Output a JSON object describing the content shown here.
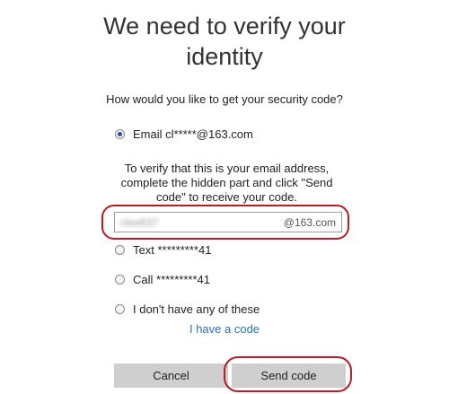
{
  "header": {
    "title_line1": "We need to verify your",
    "title_line2": "identity"
  },
  "prompt": "How would you like to get your security code?",
  "options": {
    "email": {
      "label": "Email cl*****@163.com",
      "selected": true
    },
    "text": {
      "label": "Text *********41",
      "selected": false
    },
    "call": {
      "label": "Call *********41",
      "selected": false
    },
    "none": {
      "label": "I don't have any of these",
      "selected": false
    }
  },
  "help_text": "To verify that this is your email address, complete the hidden part and click \"Send code\" to receive your code.",
  "email_field": {
    "value": "clee637",
    "suffix": "@163.com"
  },
  "have_code_link": "I have a code",
  "buttons": {
    "cancel": "Cancel",
    "send": "Send code"
  },
  "colors": {
    "accent": "#2672c0",
    "highlight": "#b51d22",
    "button_bg": "#cfcfcf"
  }
}
